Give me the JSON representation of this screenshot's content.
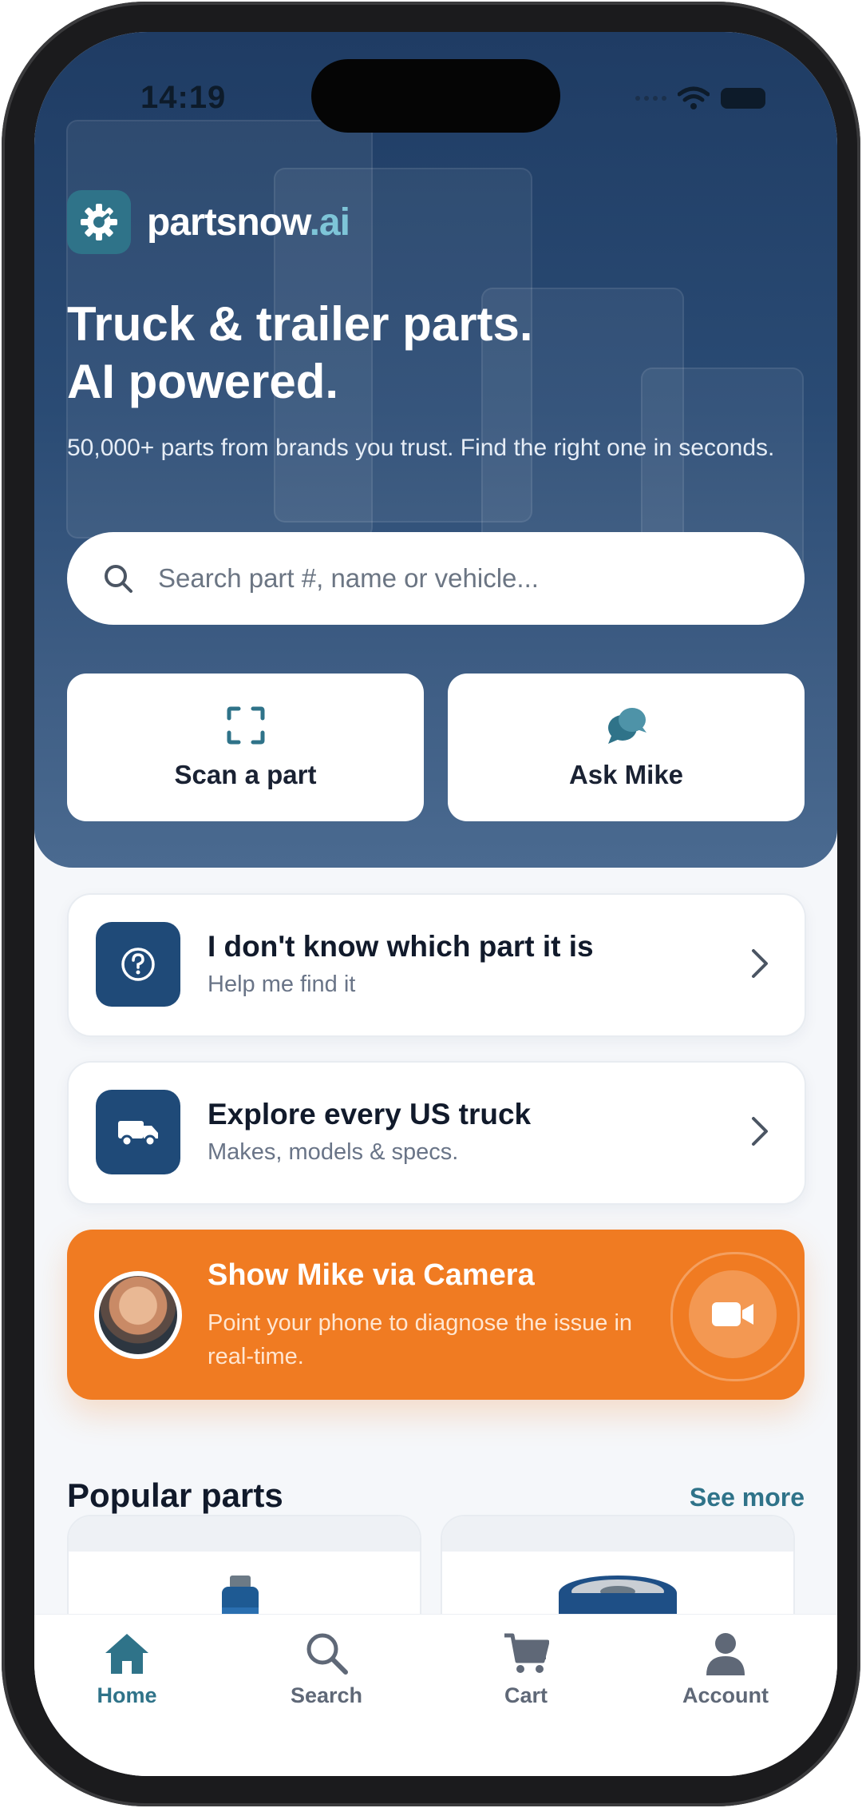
{
  "status_bar": {
    "time": "14:19"
  },
  "brand": {
    "name_main": "partsnow",
    "name_suffix": ".ai",
    "accent": "#2f7389",
    "icon": "gear-logo-icon"
  },
  "hero": {
    "headline_line1": "Truck & trailer parts.",
    "headline_line2": "AI powered.",
    "subtitle": "50,000+ parts from brands you trust. Find the right one in seconds."
  },
  "search": {
    "placeholder": "Search part #, name or vehicle..."
  },
  "quick_actions": [
    {
      "label": "Scan a part",
      "icon": "scan-icon"
    },
    {
      "label": "Ask Mike",
      "icon": "chat-bubbles-icon"
    }
  ],
  "cards": [
    {
      "title": "I don't know which part it is",
      "subtitle": "Help me find it",
      "icon": "question-circle-icon"
    },
    {
      "title": "Explore every US truck",
      "subtitle": "Makes, models & specs.",
      "icon": "truck-icon"
    }
  ],
  "camera_banner": {
    "title": "Show Mike via Camera",
    "description": "Point your phone to diagnose the issue in real-time.",
    "icon": "video-camera-icon",
    "color": "#f07b22"
  },
  "popular": {
    "title": "Popular parts",
    "see_more": "See more"
  },
  "tabs": [
    {
      "label": "Home",
      "icon": "home-icon",
      "active": true
    },
    {
      "label": "Search",
      "icon": "search-icon",
      "active": false
    },
    {
      "label": "Cart",
      "icon": "cart-icon",
      "active": false
    },
    {
      "label": "Account",
      "icon": "account-icon",
      "active": false
    }
  ]
}
